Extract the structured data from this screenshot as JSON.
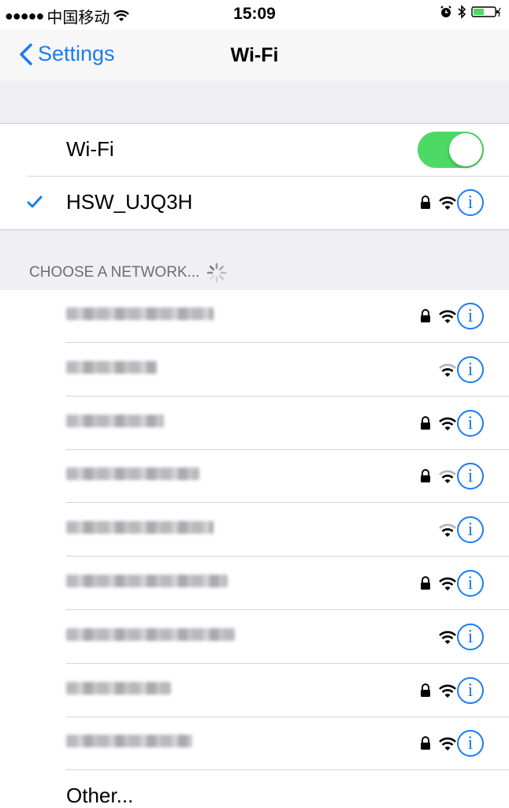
{
  "status_bar": {
    "signal": "●●●●●",
    "carrier": "中国移动",
    "time": "15:09"
  },
  "nav": {
    "back_label": "Settings",
    "title": "Wi-Fi"
  },
  "wifi_toggle": {
    "label": "Wi-Fi",
    "enabled": true
  },
  "connected": {
    "name": "HSW_UJQ3H",
    "secured": true,
    "signal": "full"
  },
  "section": {
    "label": "CHOOSE A NETWORK..."
  },
  "networks": [
    {
      "name": "Chinanet-XXXX",
      "secured": true,
      "signal": "full"
    },
    {
      "name": "Guest",
      "secured": false,
      "signal": "medium"
    },
    {
      "name": "KKX_WF",
      "secured": true,
      "signal": "full"
    },
    {
      "name": "HongBaoLink",
      "secured": true,
      "signal": "medium"
    },
    {
      "name": "GuestMobilePC",
      "secured": false,
      "signal": "medium"
    },
    {
      "name": "Mingfu-Wireless",
      "secured": true,
      "signal": "full"
    },
    {
      "name": "Noosp-Sonpt0X-AK",
      "secured": false,
      "signal": "full"
    },
    {
      "name": "Dingxia",
      "secured": true,
      "signal": "full"
    },
    {
      "name": "Xingxia_5G",
      "secured": true,
      "signal": "full"
    }
  ],
  "other_label": "Other...",
  "colors": {
    "accent": "#1a7cf5",
    "toggle_on": "#4cd964",
    "group_bg": "#efeff4"
  }
}
